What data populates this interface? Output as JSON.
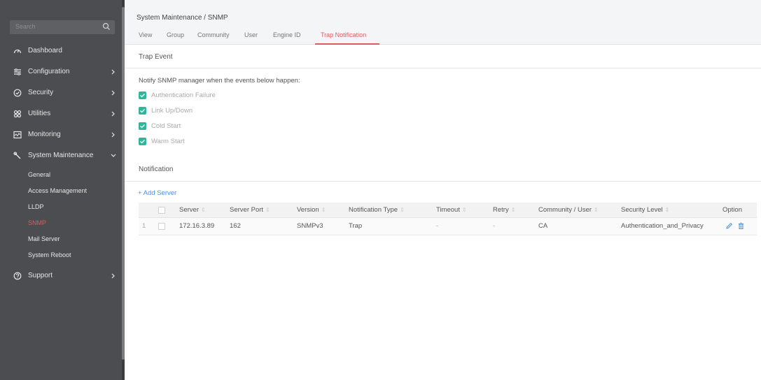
{
  "sidebar": {
    "search_placeholder": "Search",
    "items": [
      {
        "label": "Dashboard",
        "icon": "dashboard-icon",
        "has_chevron": false
      },
      {
        "label": "Configuration",
        "icon": "configuration-icon",
        "has_chevron": true
      },
      {
        "label": "Security",
        "icon": "shield-icon",
        "has_chevron": true
      },
      {
        "label": "Utilities",
        "icon": "utilities-icon",
        "has_chevron": true
      },
      {
        "label": "Monitoring",
        "icon": "monitoring-icon",
        "has_chevron": true
      },
      {
        "label": "System Maintenance",
        "icon": "wrench-icon",
        "has_chevron": true,
        "expanded": true
      }
    ],
    "sub_items": [
      "General",
      "Access Management",
      "LLDP",
      "SNMP",
      "Mail Server",
      "System Reboot"
    ],
    "active_sub": "SNMP",
    "support": {
      "label": "Support",
      "icon": "help-icon"
    }
  },
  "header": {
    "breadcrumb": "System Maintenance / SNMP",
    "tabs": [
      "View",
      "Group",
      "Community",
      "User",
      "Engine ID",
      "Trap Notification"
    ],
    "active_tab": "Trap Notification"
  },
  "trap_event": {
    "title": "Trap Event",
    "notify_text": "Notify SNMP manager when the events below happen:",
    "events": [
      {
        "label": "Authentication Failure",
        "checked": true
      },
      {
        "label": "Link Up/Down",
        "checked": true
      },
      {
        "label": "Cold Start",
        "checked": true
      },
      {
        "label": "Warm Start",
        "checked": true
      }
    ]
  },
  "notification": {
    "title": "Notification",
    "add_server": "+ Add Server",
    "columns": [
      "Server",
      "Server Port",
      "Version",
      "Notification Type",
      "Timeout",
      "Retry",
      "Community / User",
      "Security Level",
      "Option"
    ],
    "rows": [
      {
        "index": "1",
        "server": "172.16.3.89",
        "server_port": "162",
        "version": "SNMPv3",
        "notification_type": "Trap",
        "timeout": "-",
        "retry": "-",
        "community_user": "CA",
        "security_level": "Authentication_and_Privacy"
      }
    ]
  },
  "colors": {
    "accent": "#e05a5a",
    "link": "#4a90e2",
    "check": "#2fb59a",
    "sidebar_bg": "#4b4d50"
  }
}
